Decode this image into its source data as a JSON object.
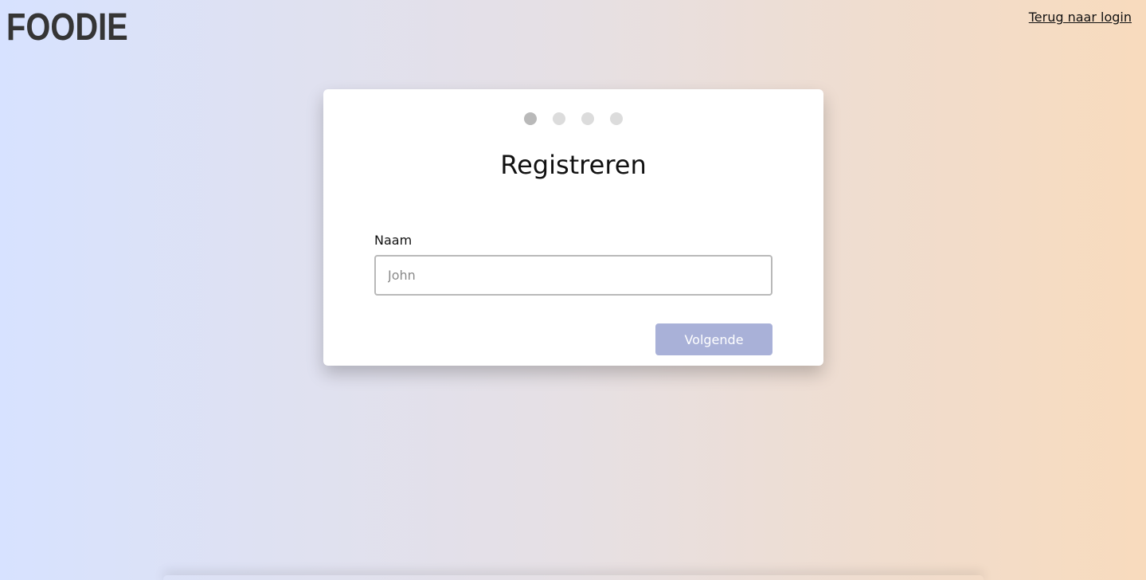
{
  "header": {
    "logo_text": "FOODIE",
    "back_link_label": "Terug naar login"
  },
  "registration": {
    "steps": [
      {
        "active": true
      },
      {
        "active": false
      },
      {
        "active": false
      },
      {
        "active": false
      }
    ],
    "current_step": 1,
    "total_steps": 4,
    "title": "Registreren",
    "name_label": "Naam",
    "name_placeholder": "John",
    "name_value": "",
    "next_label": "Volgende"
  },
  "colors": {
    "gradient_left": "#d7e2ff",
    "gradient_right": "#f8dbbd",
    "button": "#a9b1d8",
    "dot_active": "#b9b9b9",
    "dot_inactive": "#dcdcdc"
  }
}
